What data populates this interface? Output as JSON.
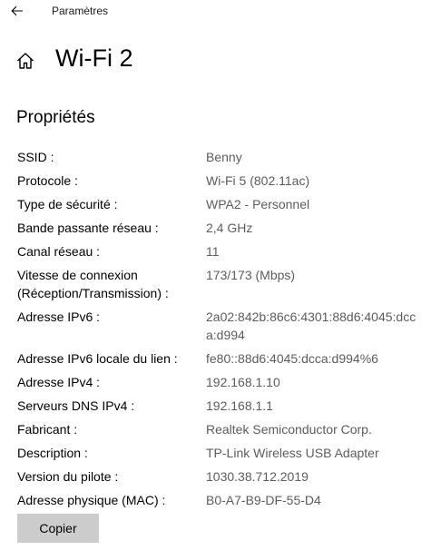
{
  "window": {
    "app_title": "Paramètres"
  },
  "header": {
    "title": "Wi-Fi 2",
    "icon": "home-icon"
  },
  "properties": {
    "section_title": "Propriétés",
    "items": [
      {
        "label": "SSID :",
        "value": "Benny"
      },
      {
        "label": "Protocole :",
        "value": "Wi-Fi 5 (802.11ac)"
      },
      {
        "label": "Type de sécurité :",
        "value": "WPA2 - Personnel"
      },
      {
        "label": "Bande passante réseau :",
        "value": "2,4 GHz"
      },
      {
        "label": "Canal réseau :",
        "value": "11"
      },
      {
        "label": [
          "Vitesse de connexion",
          "(Réception/Transmission) :"
        ],
        "value": "173/173 (Mbps)"
      },
      {
        "label": "Adresse IPv6 :",
        "value": [
          "2a02:842b:86c6:4301:88d6:4045:dcc",
          "a:d994"
        ]
      },
      {
        "label": "Adresse IPv6 locale du lien :",
        "value": "fe80::88d6:4045:dcca:d994%6"
      },
      {
        "label": "Adresse IPv4 :",
        "value": "192.168.1.10"
      },
      {
        "label": "Serveurs DNS IPv4 :",
        "value": "192.168.1.1"
      },
      {
        "label": "Fabricant :",
        "value": "Realtek Semiconductor Corp."
      },
      {
        "label": "Description :",
        "value": "TP-Link Wireless USB Adapter"
      },
      {
        "label": "Version du pilote :",
        "value": "1030.38.712.2019"
      },
      {
        "label": "Adresse physique (MAC) :",
        "value": "B0-A7-B9-DF-55-D4"
      }
    ]
  },
  "actions": {
    "copy_label": "Copier"
  }
}
